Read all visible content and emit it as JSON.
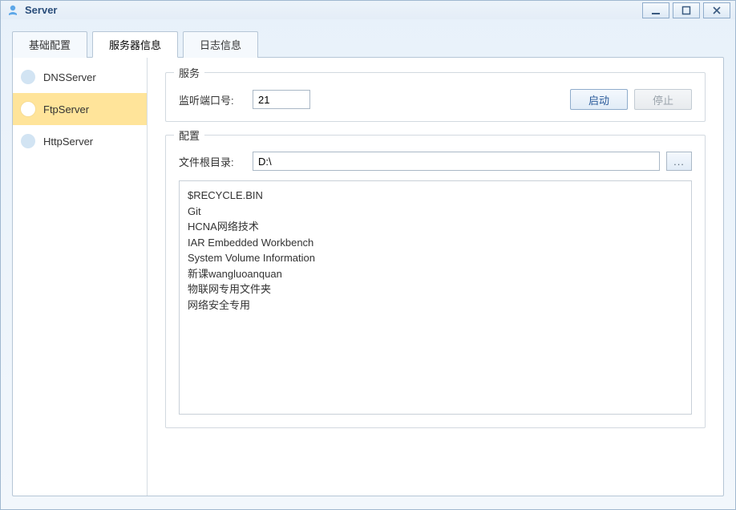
{
  "window": {
    "title": "Server"
  },
  "tabs": [
    {
      "label": "基础配置",
      "active": false
    },
    {
      "label": "服务器信息",
      "active": true
    },
    {
      "label": "日志信息",
      "active": false
    }
  ],
  "sidebar": {
    "items": [
      {
        "label": "DNSServer",
        "selected": false
      },
      {
        "label": "FtpServer",
        "selected": true
      },
      {
        "label": "HttpServer",
        "selected": false
      }
    ]
  },
  "service_group": {
    "title": "服务",
    "port_label": "监听端口号:",
    "port_value": "21",
    "start_label": "启动",
    "stop_label": "停止"
  },
  "config_group": {
    "title": "配置",
    "root_label": "文件根目录:",
    "root_value": "D:\\",
    "browse_label": "...",
    "files": [
      "$RECYCLE.BIN",
      "Git",
      "HCNA网络技术",
      "IAR Embedded Workbench",
      "System Volume Information",
      "新课wangluoanquan",
      "物联网专用文件夹",
      "网络安全专用"
    ]
  }
}
